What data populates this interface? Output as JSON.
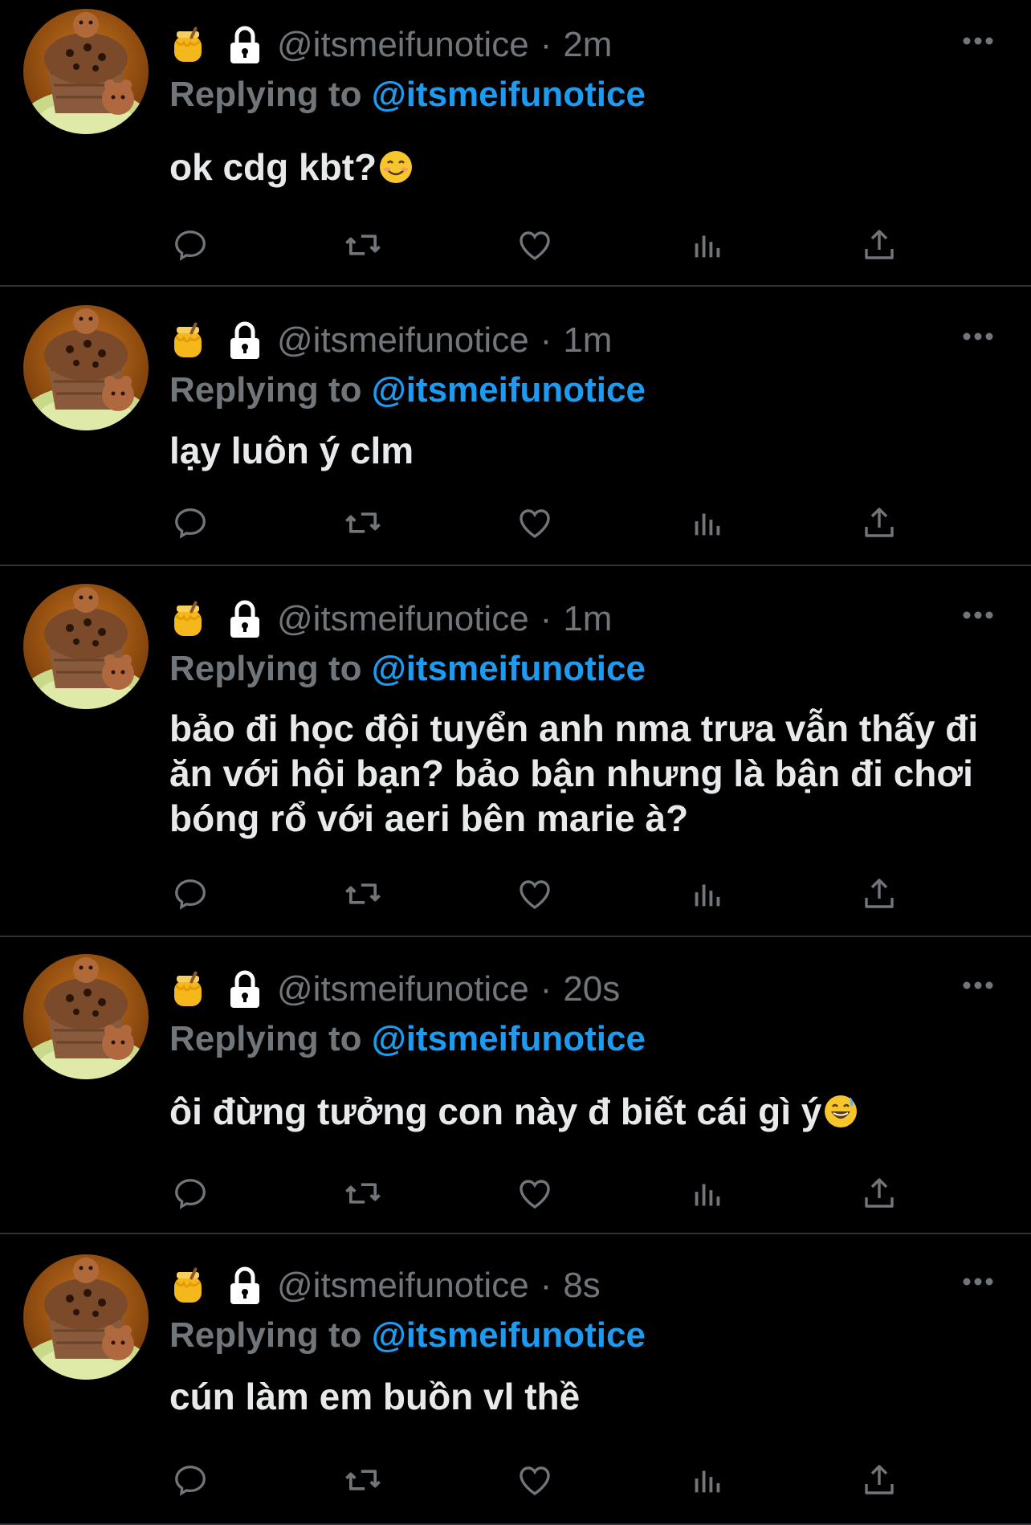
{
  "replying_label": "Replying to",
  "icons": {
    "header": [
      "honey-pot-icon",
      "lock-icon"
    ],
    "more": "more-options-icon",
    "actions": [
      "reply-icon",
      "retweet-icon",
      "like-icon",
      "analytics-icon",
      "share-icon"
    ]
  },
  "colors": {
    "background": "#000000",
    "muted": "#71767b",
    "mention": "#1d9bf0",
    "text": "#e7e9ea",
    "divider": "#2f3336"
  },
  "tweets": [
    {
      "handle": "@itsmeifunotice",
      "separator": "·",
      "time": "2m",
      "reply_to": "@itsmeifunotice",
      "text": "ok cdg kbt?",
      "emoji": "smiling-face-emoji"
    },
    {
      "handle": "@itsmeifunotice",
      "separator": "·",
      "time": "1m",
      "reply_to": "@itsmeifunotice",
      "text": "lạy luôn ý clm"
    },
    {
      "handle": "@itsmeifunotice",
      "separator": "·",
      "time": "1m",
      "reply_to": "@itsmeifunotice",
      "text": "bảo đi học đội tuyển anh nma trưa vẫn thấy đi ăn với hội bạn? bảo bận nhưng là bận đi chơi bóng rổ với aeri bên marie à?"
    },
    {
      "handle": "@itsmeifunotice",
      "separator": "·",
      "time": "20s",
      "reply_to": "@itsmeifunotice",
      "text": "ôi đừng tưởng con này đ biết cái gì ý",
      "emoji": "grinning-sweat-emoji"
    },
    {
      "handle": "@itsmeifunotice",
      "separator": "·",
      "time": "8s",
      "reply_to": "@itsmeifunotice",
      "text": "cún làm em buồn vl thề"
    }
  ]
}
